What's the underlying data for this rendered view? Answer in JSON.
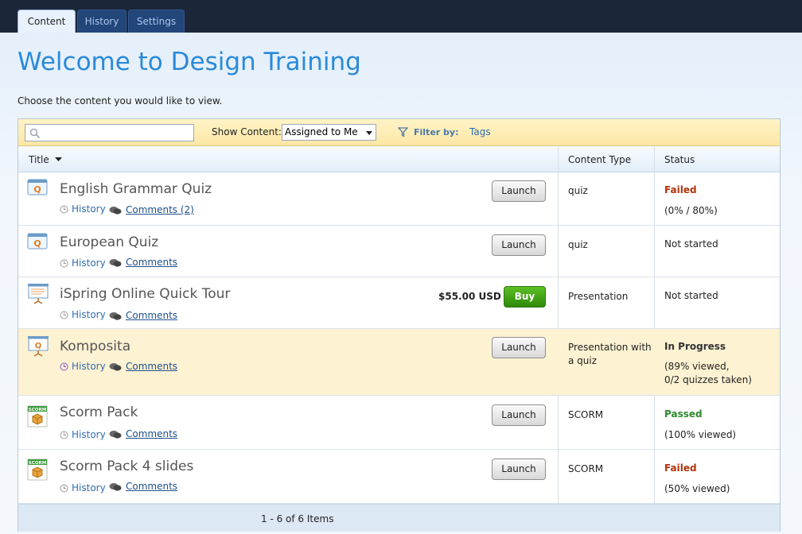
{
  "tabs": [
    {
      "label": "Content"
    },
    {
      "label": "History"
    },
    {
      "label": "Settings"
    }
  ],
  "page": {
    "title": "Welcome to Design Training",
    "subtitle": "Choose the content you would like to view."
  },
  "toolbar": {
    "search_placeholder": "",
    "show_content_label": "Show Content:",
    "show_content_value": "Assigned to Me",
    "filter_label": "Filter by:",
    "tags_label": "Tags"
  },
  "columns": {
    "title": "Title",
    "content_type": "Content Type",
    "status": "Status"
  },
  "items": [
    {
      "title": "English Grammar Quiz",
      "icon": "quiz-icon",
      "history": "History",
      "comments": "Comments (2)",
      "action": "Launch",
      "content_type": "quiz",
      "status": "Failed",
      "detail": "(0% / 80%)"
    },
    {
      "title": "European Quiz",
      "icon": "quiz-icon",
      "history": "History",
      "comments": "Comments",
      "action": "Launch",
      "content_type": "quiz",
      "status": "Not started",
      "detail": ""
    },
    {
      "title": "iSpring Online Quick Tour",
      "icon": "presentation-icon",
      "history": "History",
      "comments": "Comments",
      "price": "$55.00 USD",
      "action": "Buy",
      "content_type": "Presentation",
      "status": "Not started",
      "detail": ""
    },
    {
      "title": "Komposita",
      "icon": "presentation-quiz-icon",
      "history": "History",
      "comments": "Comments",
      "action": "Launch",
      "content_type": "Presentation with a quiz",
      "status": "In Progress",
      "detail": "(89% viewed,",
      "detail2": "0/2 quizzes taken)"
    },
    {
      "title": "Scorm Pack",
      "icon": "scorm-icon",
      "history": "History",
      "comments": "Comments",
      "action": "Launch",
      "content_type": "SCORM",
      "status": "Passed",
      "detail": "(100% viewed)"
    },
    {
      "title": "Scorm Pack 4 slides",
      "icon": "scorm-icon",
      "history": "History",
      "comments": "Comments",
      "action": "Launch",
      "content_type": "SCORM",
      "status": "Failed",
      "detail": "(50% viewed)"
    }
  ],
  "pager": "1 - 6 of 6 Items",
  "colors": {
    "topbar": "#1b2638",
    "title": "#2a8ad8",
    "failed": "#b2330c",
    "passed": "#2e8a2e",
    "buy": "#3f9c14",
    "highlight_row": "#fdf2d2"
  }
}
